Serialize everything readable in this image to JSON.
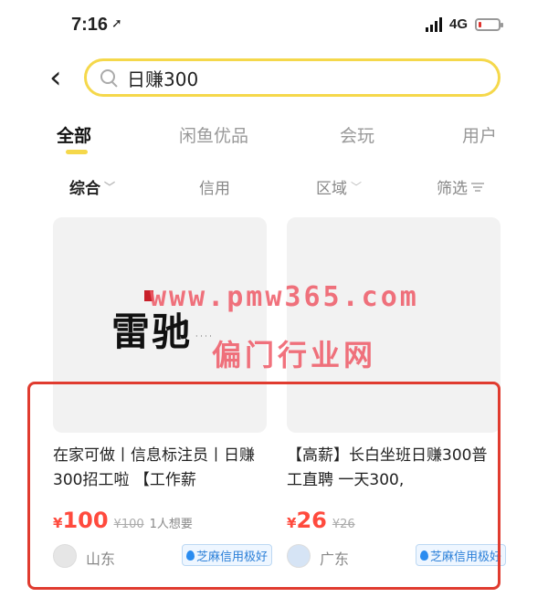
{
  "status_bar": {
    "time": "7:16",
    "location_arrow": "➚",
    "network": "4G",
    "battery_level": 0.15
  },
  "search": {
    "back_icon": "‹",
    "query": "日赚300"
  },
  "tabs": [
    {
      "label": "全部",
      "active": true
    },
    {
      "label": "闲鱼优品",
      "active": false
    },
    {
      "label": "会玩",
      "active": false
    },
    {
      "label": "用户",
      "active": false
    }
  ],
  "filters": [
    {
      "label": "综合",
      "active": true,
      "icon": "chevron-down-icon"
    },
    {
      "label": "信用",
      "active": false,
      "icon": ""
    },
    {
      "label": "区域",
      "active": false,
      "icon": "chevron-down-icon"
    },
    {
      "label": "筛选",
      "active": false,
      "icon": "filter-icon"
    }
  ],
  "listings": [
    {
      "logo_text": "雷驰",
      "title": "在家可做丨信息标注员丨日赚300招工啦 【工作薪",
      "currency": "¥",
      "price": "100",
      "original_price": "¥100",
      "wants": "1人想要",
      "location": "山东",
      "credit": "芝麻信用极好"
    },
    {
      "logo_text": "",
      "title": "【高薪】长白坐班日赚300普工直聘 一天300,",
      "currency": "¥",
      "price": "26",
      "original_price": "¥26",
      "wants": "",
      "location": "广东",
      "credit": "芝麻信用极好"
    }
  ],
  "watermark": {
    "line1": "www.pmw365.com",
    "line2": "偏门行业网"
  },
  "colors": {
    "accent": "#f5d84b",
    "price": "#ff4a3d",
    "highlight": "#e03b2f",
    "credit": "#2a7fd8"
  }
}
